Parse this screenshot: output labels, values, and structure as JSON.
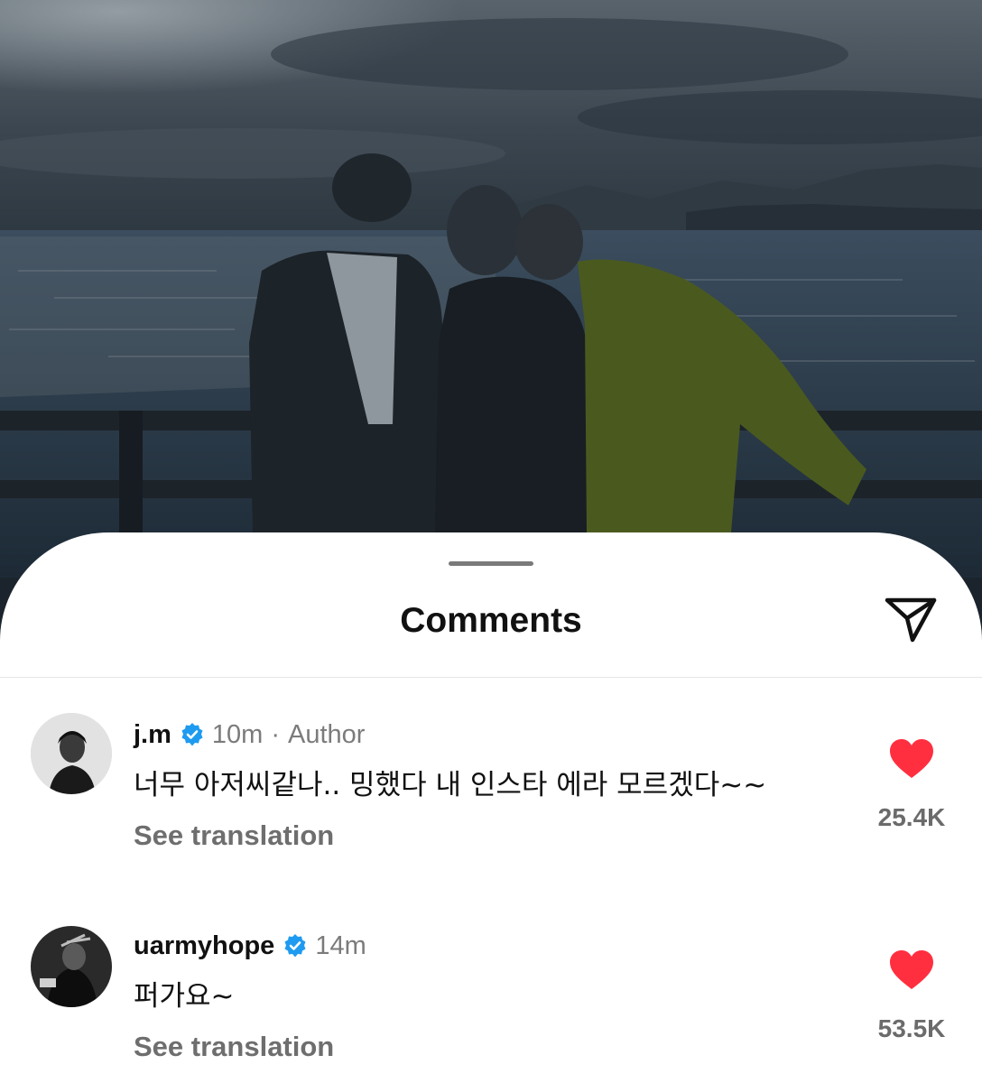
{
  "sheet": {
    "title": "Comments",
    "share_icon": "paper-plane-icon"
  },
  "comments": [
    {
      "username": "j.m",
      "verified": true,
      "time": "10m",
      "separator": "·",
      "role": "Author",
      "text": "너무 아저씨같나.. 밍했다 내 인스타 에라 모르겠다~~",
      "translate_label": "See translation",
      "like_icon": "heart-filled-icon",
      "likes": "25.4K"
    },
    {
      "username": "uarmyhope",
      "verified": true,
      "time": "14m",
      "text": "퍼가요~",
      "translate_label": "See translation",
      "like_icon": "heart-filled-icon",
      "likes": "53.5K"
    }
  ],
  "colors": {
    "verified_blue": "#1e9bf0",
    "like_red": "#ff2f40",
    "secondary_text": "#7b7b7b"
  }
}
